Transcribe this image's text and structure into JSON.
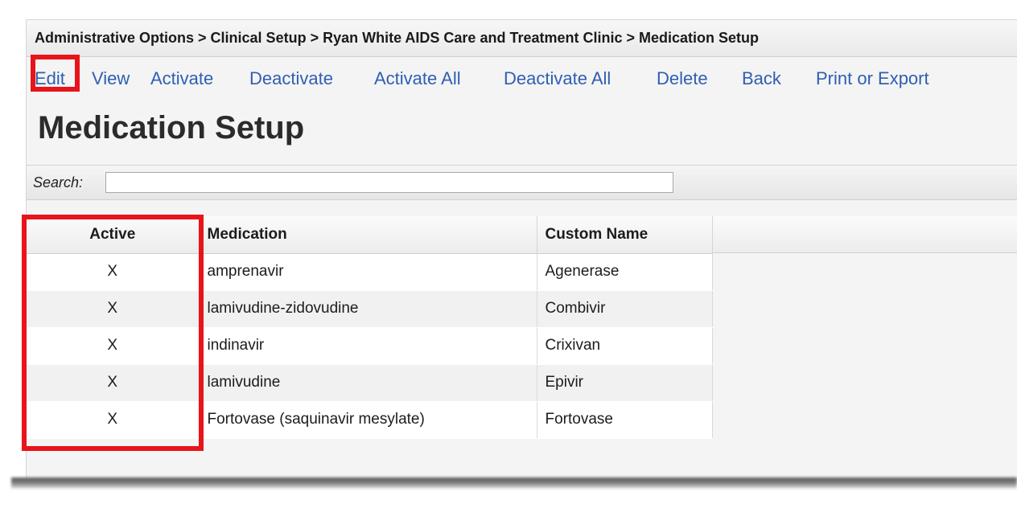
{
  "breadcrumb": "Administrative Options > Clinical Setup > Ryan White AIDS Care and Treatment Clinic > Medication Setup",
  "toolbar": {
    "edit": "Edit",
    "view": "View",
    "activate": "Activate",
    "deactivate": "Deactivate",
    "activate_all": "Activate All",
    "deactivate_all": "Deactivate All",
    "delete": "Delete",
    "back": "Back",
    "print_export": "Print or Export"
  },
  "page_title": "Medication Setup",
  "search": {
    "label": "Search:",
    "value": ""
  },
  "table": {
    "headers": {
      "active": "Active",
      "medication": "Medication",
      "custom_name": "Custom Name"
    },
    "rows": [
      {
        "active": "X",
        "medication": "amprenavir",
        "custom_name": "Agenerase"
      },
      {
        "active": "X",
        "medication": "lamivudine-zidovudine",
        "custom_name": "Combivir"
      },
      {
        "active": "X",
        "medication": "indinavir",
        "custom_name": "Crixivan"
      },
      {
        "active": "X",
        "medication": "lamivudine",
        "custom_name": "Epivir"
      },
      {
        "active": "X",
        "medication": "Fortovase (saquinavir mesylate)",
        "custom_name": "Fortovase"
      }
    ]
  },
  "colors": {
    "link": "#2f5eb3",
    "highlight": "#e8141a"
  }
}
